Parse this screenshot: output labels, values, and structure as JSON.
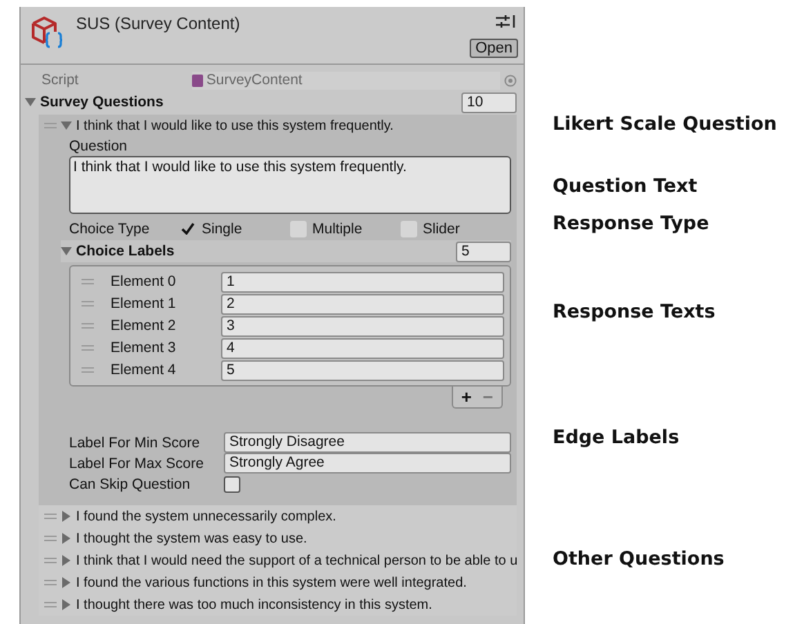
{
  "inspector": {
    "title": "SUS (Survey Content)",
    "open_button": "Open",
    "script": {
      "label": "Script",
      "value": "SurveyContent"
    },
    "survey_questions": {
      "label": "Survey Questions",
      "expanded": true,
      "count": "10",
      "items": [
        {
          "header": "I think that I would like to use this system frequently.",
          "expanded": true,
          "question_label": "Question",
          "question_text": "I think that I would like to use this system frequently.",
          "choice_type_label": "Choice Type",
          "choice_types": [
            {
              "label": "Single",
              "checked": true
            },
            {
              "label": "Multiple",
              "checked": false
            },
            {
              "label": "Slider",
              "checked": false
            }
          ],
          "choice_labels": {
            "label": "Choice Labels",
            "expanded": true,
            "count": "5",
            "elements": [
              {
                "label": "Element 0",
                "value": "1"
              },
              {
                "label": "Element 1",
                "value": "2"
              },
              {
                "label": "Element 2",
                "value": "3"
              },
              {
                "label": "Element 3",
                "value": "4"
              },
              {
                "label": "Element 4",
                "value": "5"
              }
            ],
            "add": "+",
            "remove": "−"
          },
          "min_label": {
            "label": "Label For Min Score",
            "value": "Strongly Disagree"
          },
          "max_label": {
            "label": "Label For Max Score",
            "value": "Strongly Agree"
          },
          "can_skip": {
            "label": "Can Skip Question",
            "checked": false
          }
        },
        {
          "header": "I found the system unnecessarily complex.",
          "expanded": false
        },
        {
          "header": "I thought the system was easy to use.",
          "expanded": false
        },
        {
          "header": "I think that I would need the support of a technical person to be able to u",
          "expanded": false
        },
        {
          "header": "I found the various functions in this system were well integrated.",
          "expanded": false
        },
        {
          "header": "I thought there was too much inconsistency in this system.",
          "expanded": false
        }
      ]
    }
  },
  "annotations": [
    "Likert Scale Question",
    "Question Text",
    "Response Type",
    "Response Texts",
    "Edge Labels",
    "Other Questions"
  ]
}
